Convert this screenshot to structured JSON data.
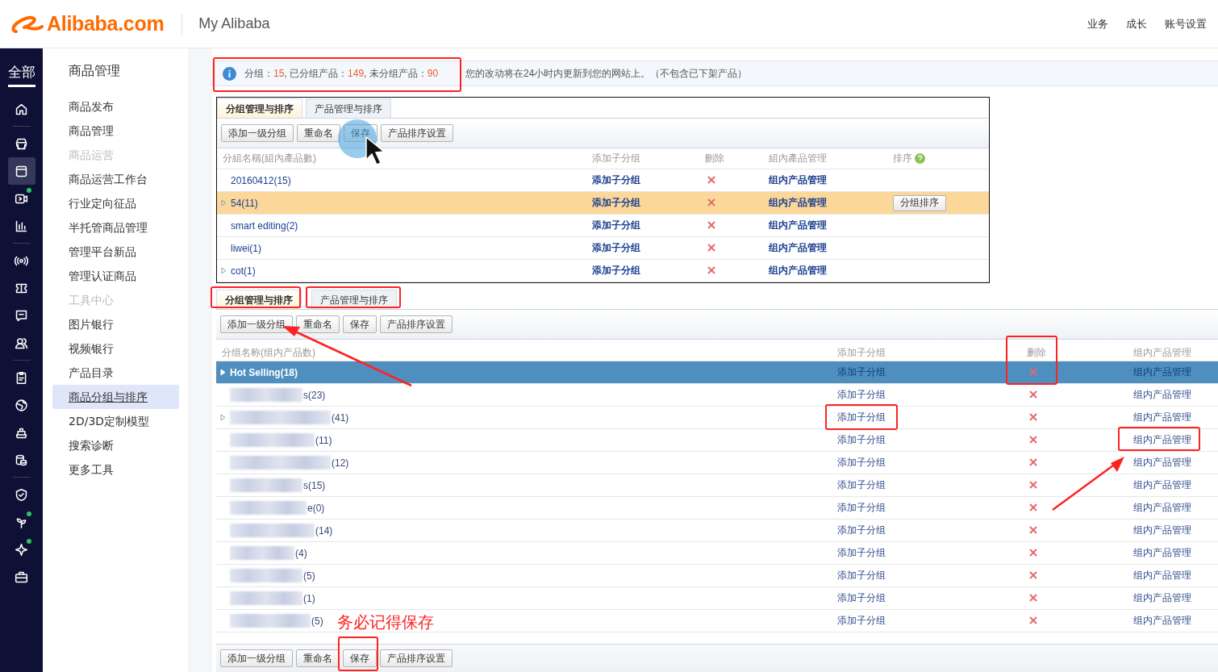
{
  "header": {
    "logo": "Alibaba.com",
    "title": "My Alibaba",
    "links": [
      "业务",
      "成长",
      "账号设置"
    ]
  },
  "rail": {
    "title": "全部",
    "items": [
      {
        "selected": false,
        "dot": false
      },
      {
        "selected": false,
        "dot": false
      },
      {
        "selected": true,
        "dot": false
      },
      {
        "selected": false,
        "dot": true
      },
      {
        "selected": false,
        "dot": false
      },
      {
        "selected": false,
        "dot": false
      },
      {
        "selected": false,
        "dot": false
      },
      {
        "selected": false,
        "dot": false
      },
      {
        "selected": false,
        "dot": false
      },
      {
        "selected": false,
        "dot": false
      },
      {
        "selected": false,
        "dot": false
      },
      {
        "selected": false,
        "dot": false
      },
      {
        "selected": false,
        "dot": false
      },
      {
        "selected": false,
        "dot": false
      },
      {
        "selected": false,
        "dot": true
      },
      {
        "selected": false,
        "dot": true
      },
      {
        "selected": false,
        "dot": false
      }
    ]
  },
  "nav": {
    "title": "商品管理",
    "items": [
      {
        "kind": "item",
        "label": "商品发布",
        "selected": false
      },
      {
        "kind": "item",
        "label": "商品管理",
        "selected": false
      },
      {
        "kind": "section",
        "label": "商品运营"
      },
      {
        "kind": "item",
        "label": "商品运营工作台",
        "selected": false
      },
      {
        "kind": "item",
        "label": "行业定向征品",
        "selected": false
      },
      {
        "kind": "item",
        "label": "半托管商品管理",
        "selected": false
      },
      {
        "kind": "item",
        "label": "管理平台新品",
        "selected": false
      },
      {
        "kind": "item",
        "label": "管理认证商品",
        "selected": false
      },
      {
        "kind": "section",
        "label": "工具中心"
      },
      {
        "kind": "item",
        "label": "图片银行",
        "selected": false
      },
      {
        "kind": "item",
        "label": "视频银行",
        "selected": false
      },
      {
        "kind": "item",
        "label": "产品目录",
        "selected": false
      },
      {
        "kind": "item",
        "label": "商品分组与排序",
        "selected": true
      },
      {
        "kind": "item",
        "label": "2D/3D定制模型",
        "selected": false
      },
      {
        "kind": "item",
        "label": "搜索诊断",
        "selected": false
      },
      {
        "kind": "item",
        "label": "更多工具",
        "selected": false
      }
    ]
  },
  "info": {
    "segments": [
      {
        "kind": "label",
        "text": "分组："
      },
      {
        "kind": "value",
        "text": "15"
      },
      {
        "kind": "label",
        "text": ", 已分组产品："
      },
      {
        "kind": "value",
        "text": "149"
      },
      {
        "kind": "label",
        "text": ", 未分组产品："
      },
      {
        "kind": "value",
        "text": "90"
      }
    ],
    "notice": "您的改动将在24小时内更新到您的网站上。（不包含已下架产品）"
  },
  "panel_1": {
    "tabs": [
      {
        "label": "分组管理与排序",
        "selected": true
      },
      {
        "label": "产品管理与排序",
        "selected": false
      }
    ],
    "toolbar": [
      "添加一级分组",
      "重命名",
      "保存",
      "产品排序设置"
    ],
    "columns": [
      "分組名稱(組內產品數)",
      "添加子分组",
      "刪除",
      "組內產品管理",
      "排序"
    ],
    "rows": [
      {
        "name": "20160412(15)",
        "has_children": false,
        "selected": false,
        "add": "添加子分组",
        "manage": "组内产品管理"
      },
      {
        "name": "54(11)",
        "has_children": true,
        "selected": true,
        "add": "添加子分组",
        "manage": "组内产品管理",
        "sort_button": "分组排序"
      },
      {
        "name": "smart editing(2)",
        "has_children": false,
        "selected": false,
        "add": "添加子分组",
        "manage": "组内产品管理"
      },
      {
        "name": "liwei(1)",
        "has_children": false,
        "selected": false,
        "add": "添加子分组",
        "manage": "组内产品管理"
      },
      {
        "name": "cot(1)",
        "has_children": true,
        "selected": false,
        "add": "添加子分组",
        "manage": "组内产品管理"
      }
    ]
  },
  "panel_2": {
    "tabs": [
      {
        "label": "分组管理与排序",
        "selected": true
      },
      {
        "label": "产品管理与排序",
        "selected": false
      }
    ],
    "toolbar": [
      "添加一级分组",
      "重命名",
      "保存",
      "产品排序设置"
    ],
    "columns": [
      "分组名称(组内产品数)",
      "添加子分组",
      "删除",
      "组内产品管理"
    ],
    "rows": [
      {
        "name": "Hot Selling(18)",
        "has_children": true,
        "selected": true,
        "redacted": false,
        "add": "添加子分组",
        "manage": "组内产品管理"
      },
      {
        "name": "s(23)",
        "has_children": false,
        "selected": false,
        "redacted": true,
        "add": "添加子分组",
        "manage": "组内产品管理"
      },
      {
        "name": "(41)",
        "has_children": true,
        "selected": false,
        "redacted": true,
        "add": "添加子分组",
        "manage": "组内产品管理"
      },
      {
        "name": "(11)",
        "has_children": false,
        "selected": false,
        "redacted": true,
        "add": "添加子分组",
        "manage": "组内产品管理"
      },
      {
        "name": "(12)",
        "has_children": false,
        "selected": false,
        "redacted": true,
        "add": "添加子分组",
        "manage": "组内产品管理"
      },
      {
        "name": "s(15)",
        "has_children": false,
        "selected": false,
        "redacted": true,
        "add": "添加子分组",
        "manage": "组内产品管理"
      },
      {
        "name": "e(0)",
        "has_children": false,
        "selected": false,
        "redacted": true,
        "add": "添加子分组",
        "manage": "组内产品管理"
      },
      {
        "name": "(14)",
        "has_children": false,
        "selected": false,
        "redacted": true,
        "add": "添加子分组",
        "manage": "组内产品管理"
      },
      {
        "name": "(4)",
        "has_children": false,
        "selected": false,
        "redacted": true,
        "add": "添加子分组",
        "manage": "组内产品管理"
      },
      {
        "name": "(5)",
        "has_children": false,
        "selected": false,
        "redacted": true,
        "add": "添加子分组",
        "manage": "组内产品管理"
      },
      {
        "name": "(1)",
        "has_children": false,
        "selected": false,
        "redacted": true,
        "add": "添加子分组",
        "manage": "组内产品管理"
      },
      {
        "name": "(5)",
        "has_children": false,
        "selected": false,
        "redacted": true,
        "add": "添加子分组",
        "manage": "组内产品管理"
      }
    ],
    "bottom_toolbar": [
      "添加一级分组",
      "重命名",
      "保存",
      "产品排序设置"
    ]
  },
  "annotation": {
    "caption": "务必记得保存"
  }
}
